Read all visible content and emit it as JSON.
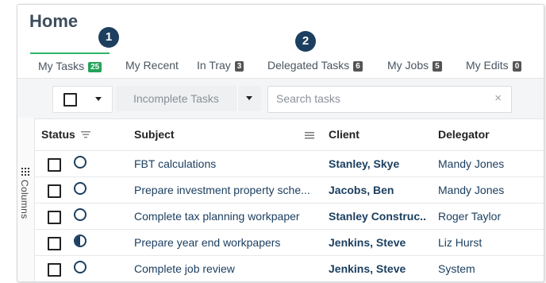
{
  "page_title": "Home",
  "callouts": [
    "1",
    "2"
  ],
  "tabs": [
    {
      "label": "My Tasks",
      "count": "25"
    },
    {
      "label": "My Recent",
      "count": ""
    },
    {
      "label": "In Tray",
      "count": "3"
    },
    {
      "label": "Delegated Tasks",
      "count": "6"
    },
    {
      "label": "My Jobs",
      "count": "5"
    },
    {
      "label": "My Edits",
      "count": "0"
    }
  ],
  "toolbar": {
    "filter_value": "Incomplete Tasks",
    "search_placeholder": "Search tasks",
    "clear_glyph": "×"
  },
  "sidebar": {
    "columns_label": "Columns"
  },
  "table": {
    "headers": {
      "status": "Status",
      "subject": "Subject",
      "client": "Client",
      "delegator": "Delegator"
    },
    "rows": [
      {
        "status": "not-started",
        "subject": "FBT calculations",
        "client": "Stanley, Skye",
        "delegator": "Mandy Jones"
      },
      {
        "status": "not-started",
        "subject": "Prepare investment property sche...",
        "client": "Jacobs, Ben",
        "delegator": "Mandy Jones"
      },
      {
        "status": "not-started",
        "subject": "Complete tax planning workpaper",
        "client": "Stanley Construc...",
        "delegator": "Roger Taylor"
      },
      {
        "status": "in-progress",
        "subject": "Prepare year end workpapers",
        "client": "Jenkins, Steve",
        "delegator": "Liz Hurst"
      },
      {
        "status": "not-started",
        "subject": "Complete job review",
        "client": "Jenkins, Steve",
        "delegator": "System"
      }
    ]
  },
  "colors": {
    "accent_green": "#2fb56a",
    "navy": "#1c3f60"
  }
}
